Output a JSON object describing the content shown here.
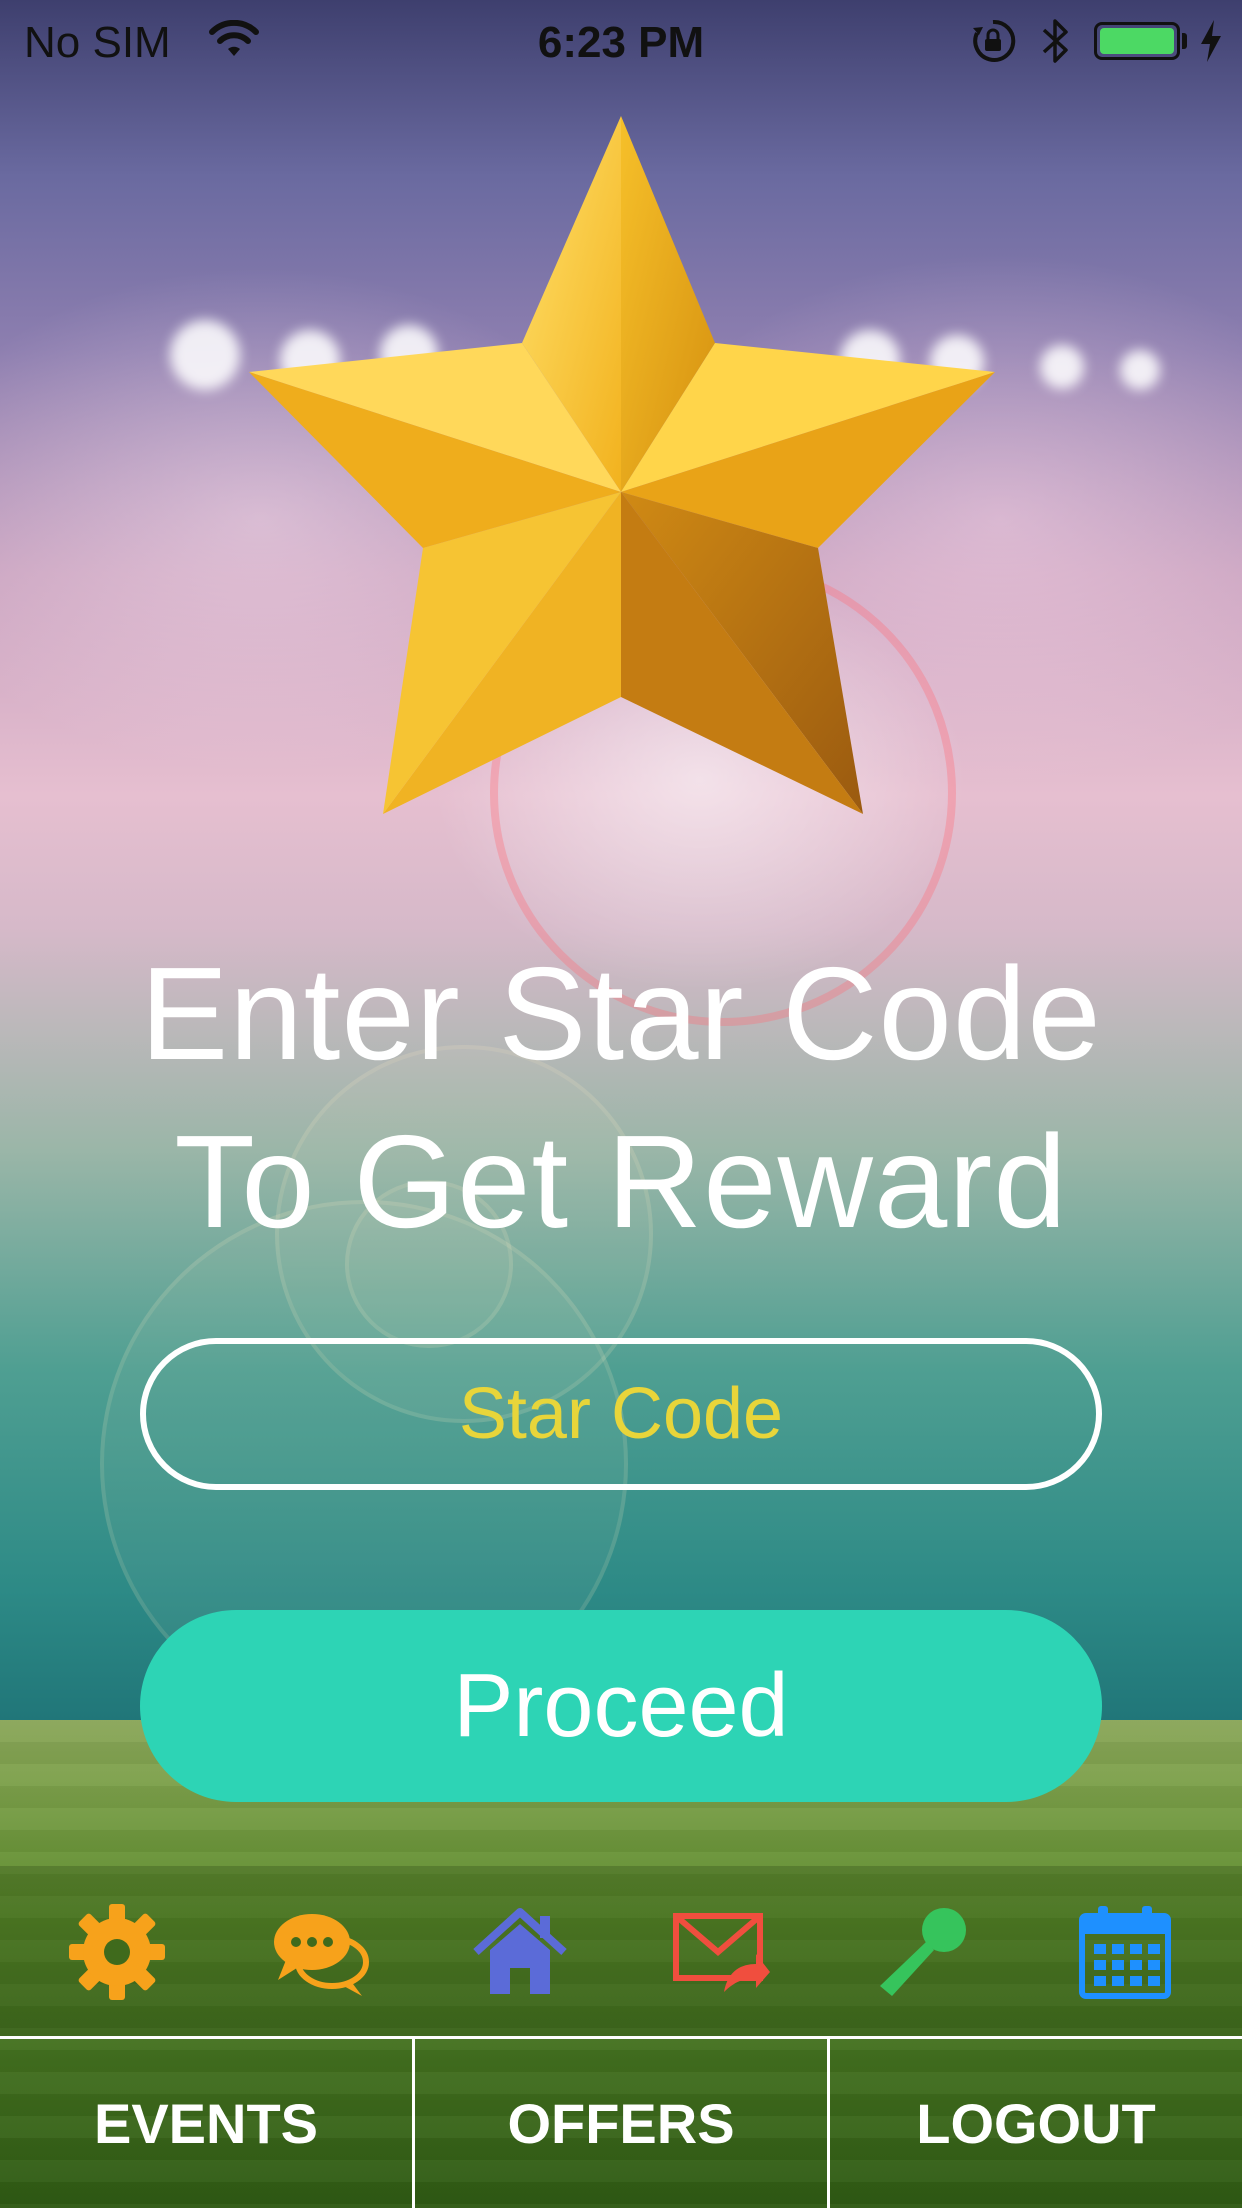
{
  "status_bar": {
    "carrier": "No SIM",
    "time": "6:23 PM",
    "battery_color": "#4cd964",
    "icons": [
      "wifi-icon",
      "orientation-lock-icon",
      "bluetooth-icon",
      "battery-icon",
      "charging-bolt-icon"
    ]
  },
  "hero": {
    "icon": "gold-star",
    "headline_line1": "Enter Star Code",
    "headline_line2": "To Get Reward"
  },
  "form": {
    "star_code_placeholder": "Star Code",
    "star_code_value": "",
    "proceed_label": "Proceed"
  },
  "toolbar": {
    "icons": [
      {
        "name": "settings-gear-icon",
        "color": "#f7a21b"
      },
      {
        "name": "chat-bubbles-icon",
        "color": "#f7a21b"
      },
      {
        "name": "home-icon",
        "color": "#5b6bd8"
      },
      {
        "name": "mail-forward-icon",
        "color": "#f04e3e"
      },
      {
        "name": "microphone-icon",
        "color": "#36c45c"
      },
      {
        "name": "calendar-icon",
        "color": "#1e90ff"
      }
    ]
  },
  "tabs": [
    {
      "label": "EVENTS"
    },
    {
      "label": "OFFERS"
    },
    {
      "label": "LOGOUT"
    }
  ],
  "colors": {
    "proceed_bg": "#2dd4b5",
    "placeholder_text": "#e8d53a"
  }
}
